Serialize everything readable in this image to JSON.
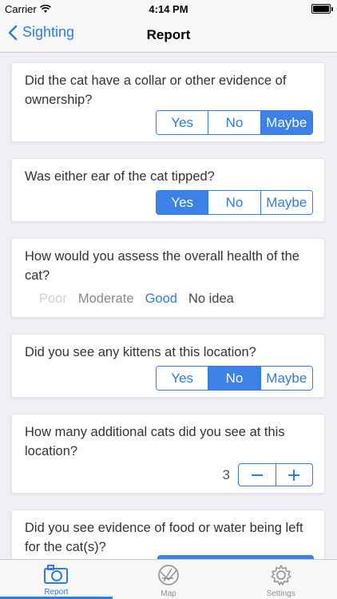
{
  "status": {
    "carrier": "Carrier",
    "time": "4:14 PM"
  },
  "nav": {
    "back_label": "Sighting",
    "title": "Report"
  },
  "questions": {
    "q1": {
      "text": "Did the cat have a collar or other evidence of ownership?",
      "options": [
        "Yes",
        "No",
        "Maybe"
      ],
      "selected": "Maybe"
    },
    "q2": {
      "text": "Was either ear of the cat tipped?",
      "options": [
        "Yes",
        "No",
        "Maybe"
      ],
      "selected": "Yes"
    },
    "q3": {
      "text": "How would you assess the overall health of the cat?",
      "options": [
        "Poor",
        "Moderate",
        "Good",
        "No idea"
      ],
      "selected": "Good"
    },
    "q4": {
      "text": "Did you see any kittens at this location?",
      "options": [
        "Yes",
        "No",
        "Maybe"
      ],
      "selected": "No"
    },
    "q5": {
      "text": "How many additional cats did you see at this location?",
      "value": "3",
      "minus": "−",
      "plus": "+"
    },
    "q6": {
      "text": "Did you see evidence of food or water being left for the cat(s)?"
    }
  },
  "tabs": [
    {
      "label": "Report",
      "icon": "camera-icon",
      "active": true
    },
    {
      "label": "Map",
      "icon": "map-icon",
      "active": false
    },
    {
      "label": "Settings",
      "icon": "gear-icon",
      "active": false
    }
  ],
  "colors": {
    "accent": "#2f7de1",
    "selected_fill": "#3c82e6",
    "background": "#efeff4"
  }
}
